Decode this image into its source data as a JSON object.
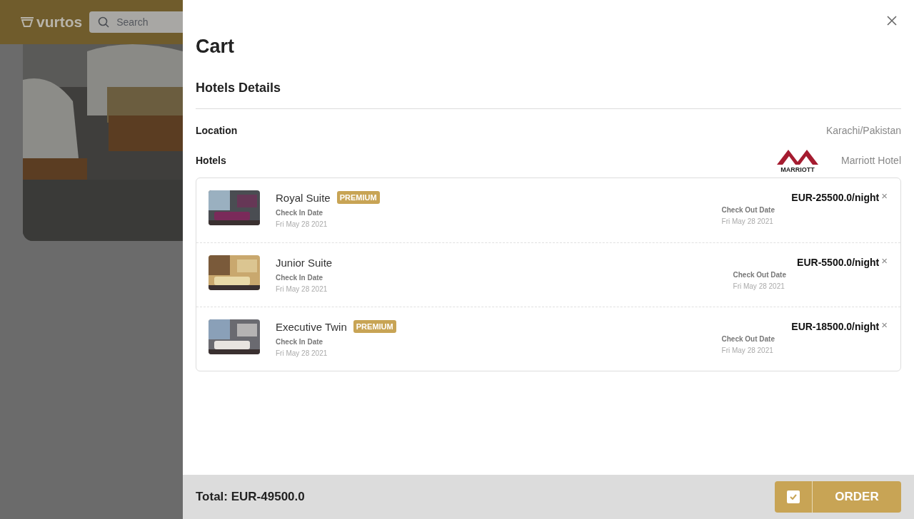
{
  "background": {
    "brand": "vurtos",
    "search": {
      "placeholder": "Search"
    }
  },
  "cart": {
    "title": "Cart",
    "section_title": "Hotels Details",
    "details": [
      {
        "label": "Location",
        "value": "Karachi/Pakistan",
        "kind": "text"
      },
      {
        "label": "Hotels",
        "value": "Marriott Hotel",
        "kind": "hotel",
        "logo_text": "MARRIOTT"
      }
    ],
    "rooms": [
      {
        "name": "Royal Suite",
        "premium": true,
        "badge": "PREMIUM",
        "check_in_label": "Check In Date",
        "check_in": "Fri May 28 2021",
        "check_out_label": "Check Out Date",
        "check_out": "Fri May 28 2021",
        "price": "EUR-25500.0/night",
        "remove": "×"
      },
      {
        "name": "Junior Suite",
        "premium": false,
        "check_in_label": "Check In Date",
        "check_in": "Fri May 28 2021",
        "check_out_label": "Check Out Date",
        "check_out": "Fri May 28 2021",
        "price": "EUR-5500.0/night",
        "remove": "×"
      },
      {
        "name": "Executive Twin",
        "premium": true,
        "badge": "PREMIUM",
        "check_in_label": "Check In Date",
        "check_in": "Fri May 28 2021",
        "check_out_label": "Check Out Date",
        "check_out": "Fri May 28 2021",
        "price": "EUR-18500.0/night",
        "remove": "×"
      }
    ],
    "total": "Total: EUR-49500.0",
    "order": {
      "label": "ORDER",
      "checked": true
    }
  }
}
